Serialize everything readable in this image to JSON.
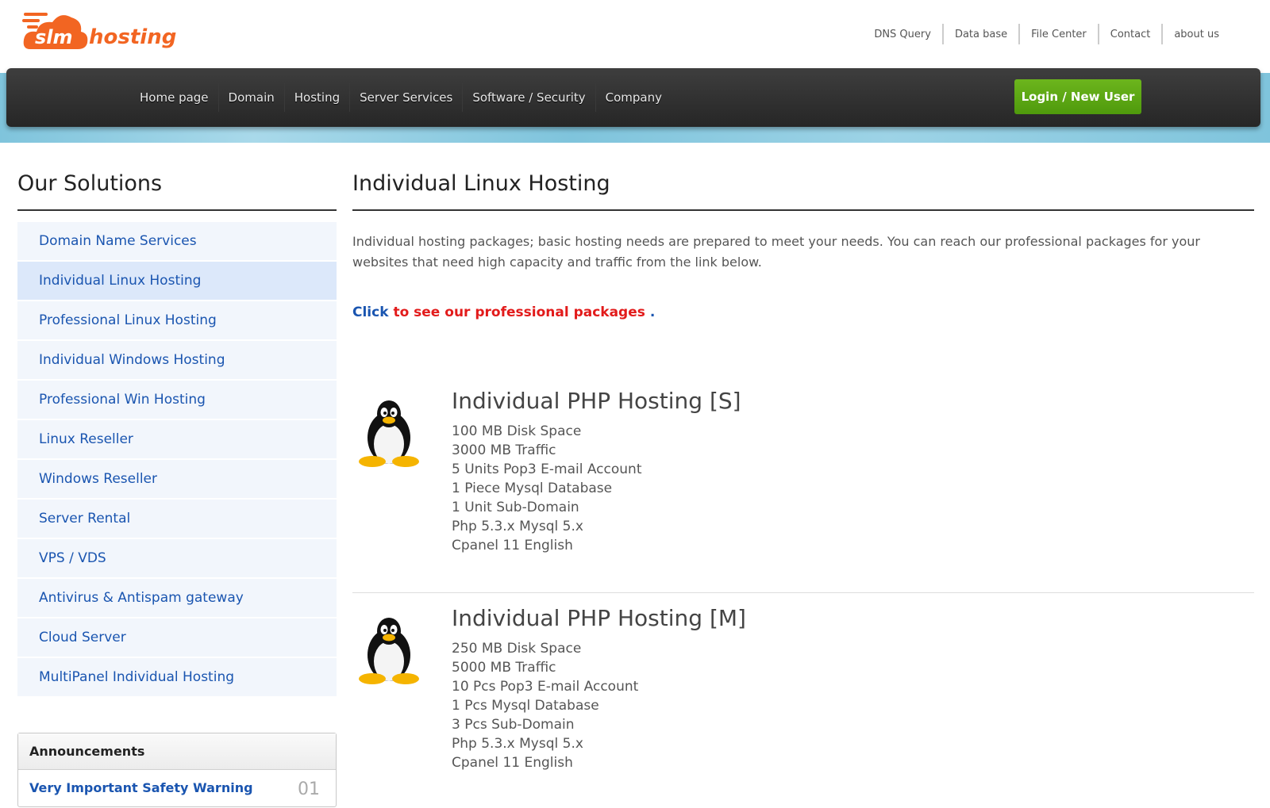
{
  "brand": {
    "logo_mark": "slm",
    "logo_word": "hosting",
    "accent": "#f26522"
  },
  "top_links": [
    "DNS Query",
    "Data base",
    "File Center",
    "Contact",
    "about us"
  ],
  "nav": {
    "items": [
      "Home page",
      "Domain",
      "Hosting",
      "Server Services",
      "Software / Security",
      "Company"
    ],
    "login_label": "Login / New User"
  },
  "sidebar": {
    "title": "Our Solutions",
    "active_index": 1,
    "items": [
      "Domain Name Services",
      "Individual Linux Hosting",
      "Professional Linux Hosting",
      "Individual Windows Hosting",
      "Professional Win Hosting",
      "Linux Reseller",
      "Windows Reseller",
      "Server Rental",
      "VPS / VDS",
      "Antivirus & Antispam gateway",
      "Cloud Server",
      "MultiPanel Individual Hosting"
    ]
  },
  "announcements": {
    "title": "Announcements",
    "items": [
      {
        "title": "Very Important Safety Warning",
        "number": "01"
      }
    ]
  },
  "main": {
    "title": "Individual Linux Hosting",
    "intro": "Individual hosting packages; basic hosting needs are prepared to meet your needs. You can reach our professional packages for your websites that need high capacity and traffic from the link below.",
    "cta": {
      "click": "Click",
      "text": "to see our professional packages",
      "dot": "."
    },
    "packages": [
      {
        "title": "Individual PHP Hosting [S]",
        "icon": "tux-penguin-icon",
        "specs": [
          "100  MB Disk Space",
          "3000  MB Traffic",
          "5  Units Pop3 E-mail Account",
          "1  Piece Mysql Database",
          "1  Unit Sub-Domain",
          "Php 5.3.x Mysql 5.x",
          "Cpanel 11 English"
        ]
      },
      {
        "title": "Individual PHP Hosting [M]",
        "icon": "tux-penguin-icon",
        "specs": [
          "250  MB Disk Space",
          "5000  MB Traffic",
          "10  Pcs Pop3 E-mail Account",
          "1  Pcs Mysql Database",
          "3  Pcs Sub-Domain",
          "Php 5.3.x Mysql 5.x",
          "Cpanel 11 English"
        ]
      }
    ]
  }
}
